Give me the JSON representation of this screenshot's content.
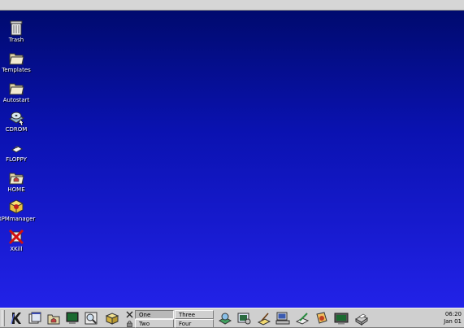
{
  "desktop": {
    "icons": [
      {
        "label": "Trash",
        "icon": "trash-icon"
      },
      {
        "label": "Templates",
        "icon": "folder-icon"
      },
      {
        "label": "Autostart",
        "icon": "folder-icon"
      },
      {
        "label": "CDROM",
        "icon": "cdrom-icon"
      },
      {
        "label": "FLOPPY",
        "icon": "floppy-icon"
      },
      {
        "label": "HOME",
        "icon": "home-folder-icon"
      },
      {
        "label": "RPMmanager",
        "icon": "package-icon"
      },
      {
        "label": "XKill",
        "icon": "xkill-icon"
      }
    ],
    "background_top": "#000a6e",
    "background_bottom": "#2222e8"
  },
  "panel": {
    "virtual_desktops": [
      {
        "label": "One",
        "active": true
      },
      {
        "label": "Two",
        "active": false
      },
      {
        "label": "Three",
        "active": false
      },
      {
        "label": "Four",
        "active": false
      }
    ],
    "clock": {
      "time": "06:20",
      "date": "Jan 01"
    }
  }
}
